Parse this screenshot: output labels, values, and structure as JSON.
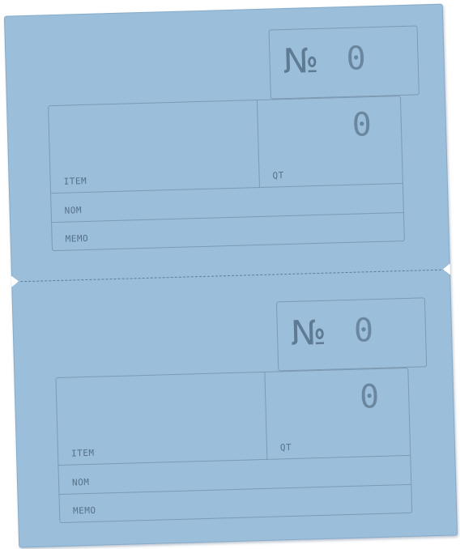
{
  "tickets": [
    {
      "number_sign": "№",
      "number_value": "0",
      "qt_value": "0",
      "labels": {
        "item": "ITEM",
        "qt": "QT",
        "nom": "NOM",
        "memo": "MEMO"
      }
    },
    {
      "number_sign": "№",
      "number_value": "0",
      "qt_value": "0",
      "labels": {
        "item": "ITEM",
        "qt": "QT",
        "nom": "NOM",
        "memo": "MEMO"
      }
    }
  ],
  "colors": {
    "paper": "#9bbfdb",
    "ink": "#5f7a93",
    "rule": "#7d9ab3"
  }
}
